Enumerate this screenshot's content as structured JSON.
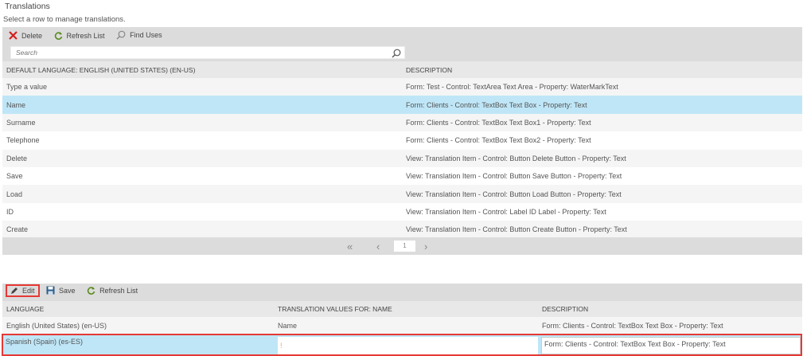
{
  "page": {
    "title": "Translations",
    "subtitle": "Select a row to manage translations."
  },
  "top_toolbar": {
    "delete": "Delete",
    "refresh": "Refresh List",
    "find_uses": "Find Uses"
  },
  "search": {
    "placeholder": "Search",
    "value": ""
  },
  "top_grid": {
    "columns": [
      "DEFAULT LANGUAGE: ENGLISH (UNITED STATES) (EN-US)",
      "DESCRIPTION"
    ],
    "selected_index": 1,
    "rows": [
      [
        "Type a value",
        "Form: Test - Control: TextArea Text Area - Property: WaterMarkText"
      ],
      [
        "Name",
        "Form: Clients - Control: TextBox Text Box - Property: Text"
      ],
      [
        "Surname",
        "Form: Clients - Control: TextBox Text Box1 - Property: Text"
      ],
      [
        "Telephone",
        "Form: Clients - Control: TextBox Text Box2 - Property: Text"
      ],
      [
        "Delete",
        "View: Translation Item - Control: Button Delete Button - Property: Text"
      ],
      [
        "Save",
        "View: Translation Item - Control: Button Save Button - Property: Text"
      ],
      [
        "Load",
        "View: Translation Item - Control: Button Load Button - Property: Text"
      ],
      [
        "ID",
        "View: Translation Item - Control: Label ID Label - Property: Text"
      ],
      [
        "Create",
        "View: Translation Item - Control: Button Create Button - Property: Text"
      ]
    ],
    "pager": {
      "page": "1"
    }
  },
  "bottom_toolbar": {
    "edit": "Edit",
    "save": "Save",
    "refresh": "Refresh List"
  },
  "bottom_grid": {
    "columns": [
      "LANGUAGE",
      "TRANSLATION VALUES FOR: NAME",
      "DESCRIPTION"
    ],
    "rows": [
      [
        "English (United States) (en-US)",
        "Name",
        "Form: Clients - Control: TextBox Text Box - Property: Text"
      ]
    ],
    "edit_row": {
      "language": "Spanish (Spain) (es-ES)",
      "value": "",
      "required_marker": "!",
      "description": "Form: Clients - Control: TextBox Text Box - Property: Text"
    }
  },
  "colors": {
    "selected": "#bfe6f7",
    "highlight": "#e53935",
    "toolbar": "#dcdcdc"
  }
}
